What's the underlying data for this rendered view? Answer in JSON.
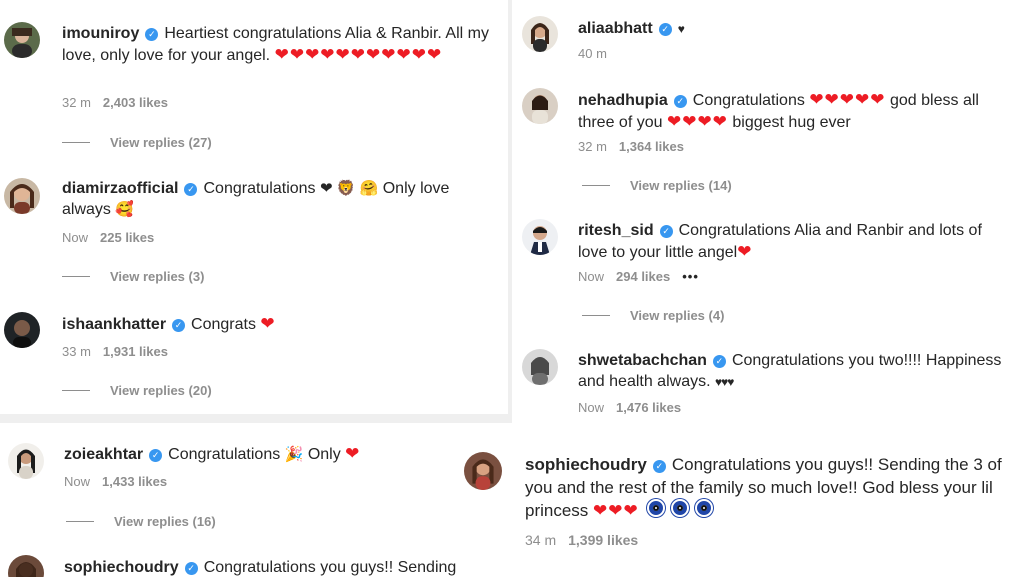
{
  "colors": {
    "verified": "#3897f0",
    "heart": "#ed1c24",
    "meta": "#8e8e8e",
    "text": "#262626"
  },
  "left_top": [
    {
      "username": "imouniroy",
      "text": "Heartiest congratulations Alia & Ranbir. All my love, only love for your angel.",
      "emojis": "❤❤❤❤❤❤❤❤❤❤❤",
      "time": "32 m",
      "likes": "2,403 likes",
      "replies": "View replies (27)"
    },
    {
      "username": "diamirzaofficial",
      "text": "Congratulations",
      "emojis_a": "❤ 🦁 🤗",
      "text_b": "Only love always",
      "emojis_b": "🥰",
      "time": "Now",
      "likes": "225 likes",
      "replies": "View replies (3)"
    },
    {
      "username": "ishaankhatter",
      "text": "Congrats",
      "emojis": "❤",
      "time": "33 m",
      "likes": "1,931 likes",
      "replies": "View replies (20)"
    }
  ],
  "right_top": [
    {
      "username": "aliaabhatt",
      "emojis": "♥",
      "time": "40 m"
    },
    {
      "username": "nehadhupia",
      "text": "Congratulations",
      "emojis_a": "❤❤❤❤❤",
      "text_b": "god bless all three of you",
      "emojis_b": "❤❤❤❤",
      "text_c": "biggest hug ever",
      "time": "32 m",
      "likes": "1,364 likes",
      "replies": "View replies (14)"
    },
    {
      "username": "ritesh_sid",
      "text": "Congratulations Alia and Ranbir and lots of love to your little angel",
      "emojis": "❤",
      "time": "Now",
      "likes": "294 likes",
      "more": "•••",
      "replies": "View replies (4)"
    },
    {
      "username": "shwetabachchan",
      "text": "Congratulations you two!!!! Happiness and health always.",
      "emojis": "♥♥♥",
      "time": "Now",
      "likes": "1,476 likes"
    }
  ],
  "left_bottom": [
    {
      "username": "zoieakhtar",
      "text": "Congratulations",
      "emojis_a": "🎉",
      "text_b": "Only",
      "emojis_b": "❤",
      "time": "Now",
      "likes": "1,433 likes",
      "replies": "View replies (16)"
    },
    {
      "username": "sophiechoudry",
      "text": "Congratulations you guys!! Sending t"
    }
  ],
  "right_bottom": [
    {
      "username": "sophiechoudry",
      "text": "Congratulations you guys!! Sending the 3 of you and the rest of the family so much love!! God bless your lil princess",
      "emojis": "❤❤❤",
      "time": "34 m",
      "likes": "1,399 likes"
    }
  ]
}
